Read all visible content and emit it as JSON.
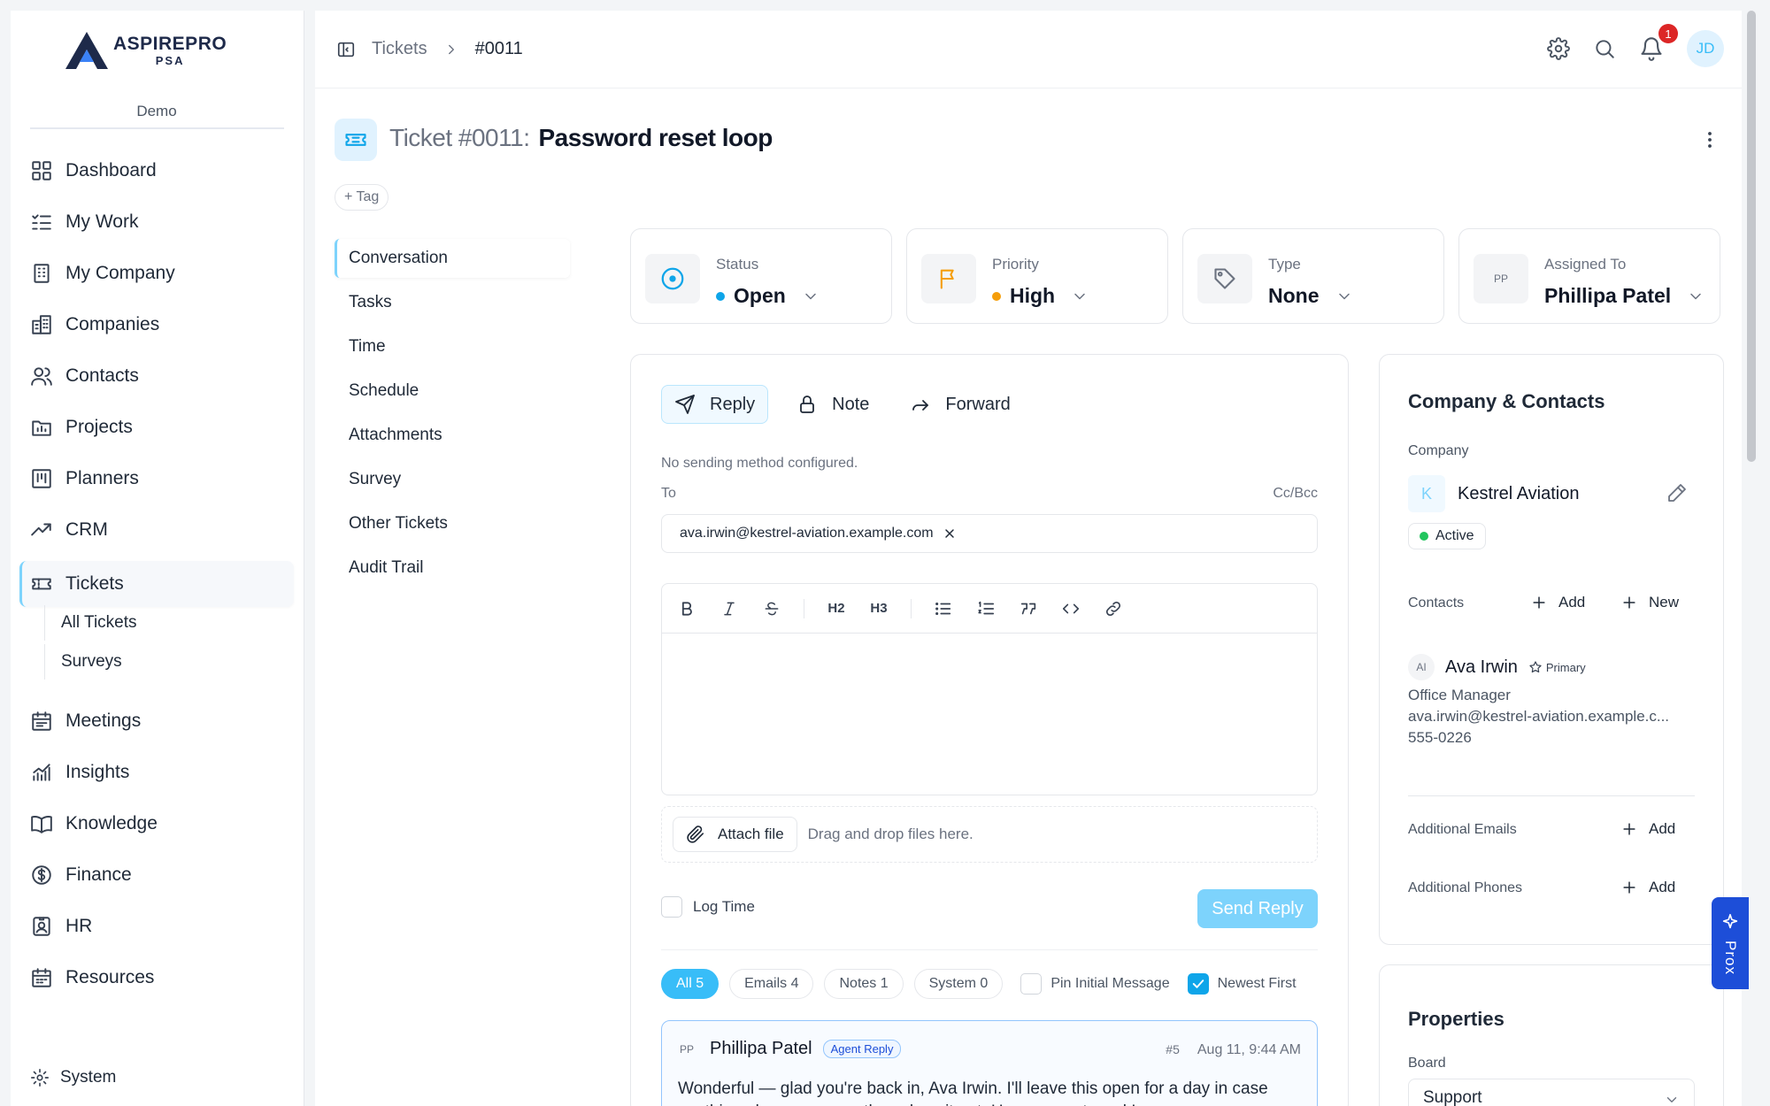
{
  "brand": {
    "name": "ASPIREPRO",
    "sub": "PSA",
    "org": "Demo"
  },
  "sidebar": {
    "items": [
      {
        "label": "Dashboard",
        "icon": "grid-icon"
      },
      {
        "label": "My Work",
        "icon": "checklist-icon"
      },
      {
        "label": "My Company",
        "icon": "building-icon"
      },
      {
        "label": "Companies",
        "icon": "buildings-icon"
      },
      {
        "label": "Contacts",
        "icon": "users-icon"
      },
      {
        "label": "Projects",
        "icon": "folder-chart-icon"
      },
      {
        "label": "Planners",
        "icon": "planner-icon"
      },
      {
        "label": "CRM",
        "icon": "trend-icon"
      },
      {
        "label": "Tickets",
        "icon": "ticket-icon",
        "active": true
      },
      {
        "label": "Meetings",
        "icon": "calendar-icon"
      },
      {
        "label": "Insights",
        "icon": "chart-icon"
      },
      {
        "label": "Knowledge",
        "icon": "book-icon"
      },
      {
        "label": "Finance",
        "icon": "dollar-icon"
      },
      {
        "label": "HR",
        "icon": "badge-icon"
      },
      {
        "label": "Resources",
        "icon": "calendar-grid-icon"
      }
    ],
    "sub_items": [
      "All Tickets",
      "Surveys"
    ],
    "system": "System"
  },
  "topbar": {
    "breadcrumb": [
      "Tickets",
      "#0011"
    ],
    "notifications": "1",
    "user_initials": "JD"
  },
  "ticket": {
    "number": "Ticket #0011:",
    "title": "Password reset loop",
    "tag_label": "+ Tag"
  },
  "ticket_nav": [
    "Conversation",
    "Tasks",
    "Time",
    "Schedule",
    "Attachments",
    "Survey",
    "Other Tickets",
    "Audit Trail"
  ],
  "fields": {
    "status": {
      "label": "Status",
      "value": "Open",
      "color": "#0ea5e9"
    },
    "priority": {
      "label": "Priority",
      "value": "High",
      "color": "#f59e0b"
    },
    "type": {
      "label": "Type",
      "value": "None"
    },
    "assigned": {
      "label": "Assigned To",
      "value": "Phillipa Patel",
      "initials": "PP"
    }
  },
  "composer": {
    "tabs": [
      "Reply",
      "Note",
      "Forward"
    ],
    "no_method": "No sending method configured.",
    "to_label": "To",
    "cc_label": "Cc/Bcc",
    "to_email": "ava.irwin@kestrel-aviation.example.com",
    "toolbar": {
      "h2": "H2",
      "h3": "H3"
    },
    "attach_label": "Attach file",
    "drop_hint": "Drag and drop files here.",
    "log_time": "Log Time",
    "send": "Send Reply",
    "filters": [
      "All 5",
      "Emails 4",
      "Notes 1",
      "System 0"
    ],
    "pin_label": "Pin Initial Message",
    "newest_label": "Newest First"
  },
  "message": {
    "initials": "PP",
    "author": "Phillipa Patel",
    "badge": "Agent Reply",
    "id": "#5",
    "time": "Aug 11, 9:44 AM",
    "body": "Wonderful — glad you're back in, Ava Irwin. I'll leave this open for a day in case anything else comes up, then close it out. Have a great week!"
  },
  "company_card": {
    "title": "Company & Contacts",
    "company_label": "Company",
    "company_initial": "K",
    "company_name": "Kestrel Aviation",
    "status": "Active",
    "contacts_label": "Contacts",
    "add": "Add",
    "new": "New",
    "contact": {
      "initials": "AI",
      "name": "Ava Irwin",
      "primary": "Primary",
      "role": "Office Manager",
      "email": "ava.irwin@kestrel-aviation.example.c...",
      "phone": "555-0226"
    },
    "emails_label": "Additional Emails",
    "phones_label": "Additional Phones"
  },
  "properties_card": {
    "title": "Properties",
    "board_label": "Board",
    "board_value": "Support"
  },
  "prox": "Prox"
}
